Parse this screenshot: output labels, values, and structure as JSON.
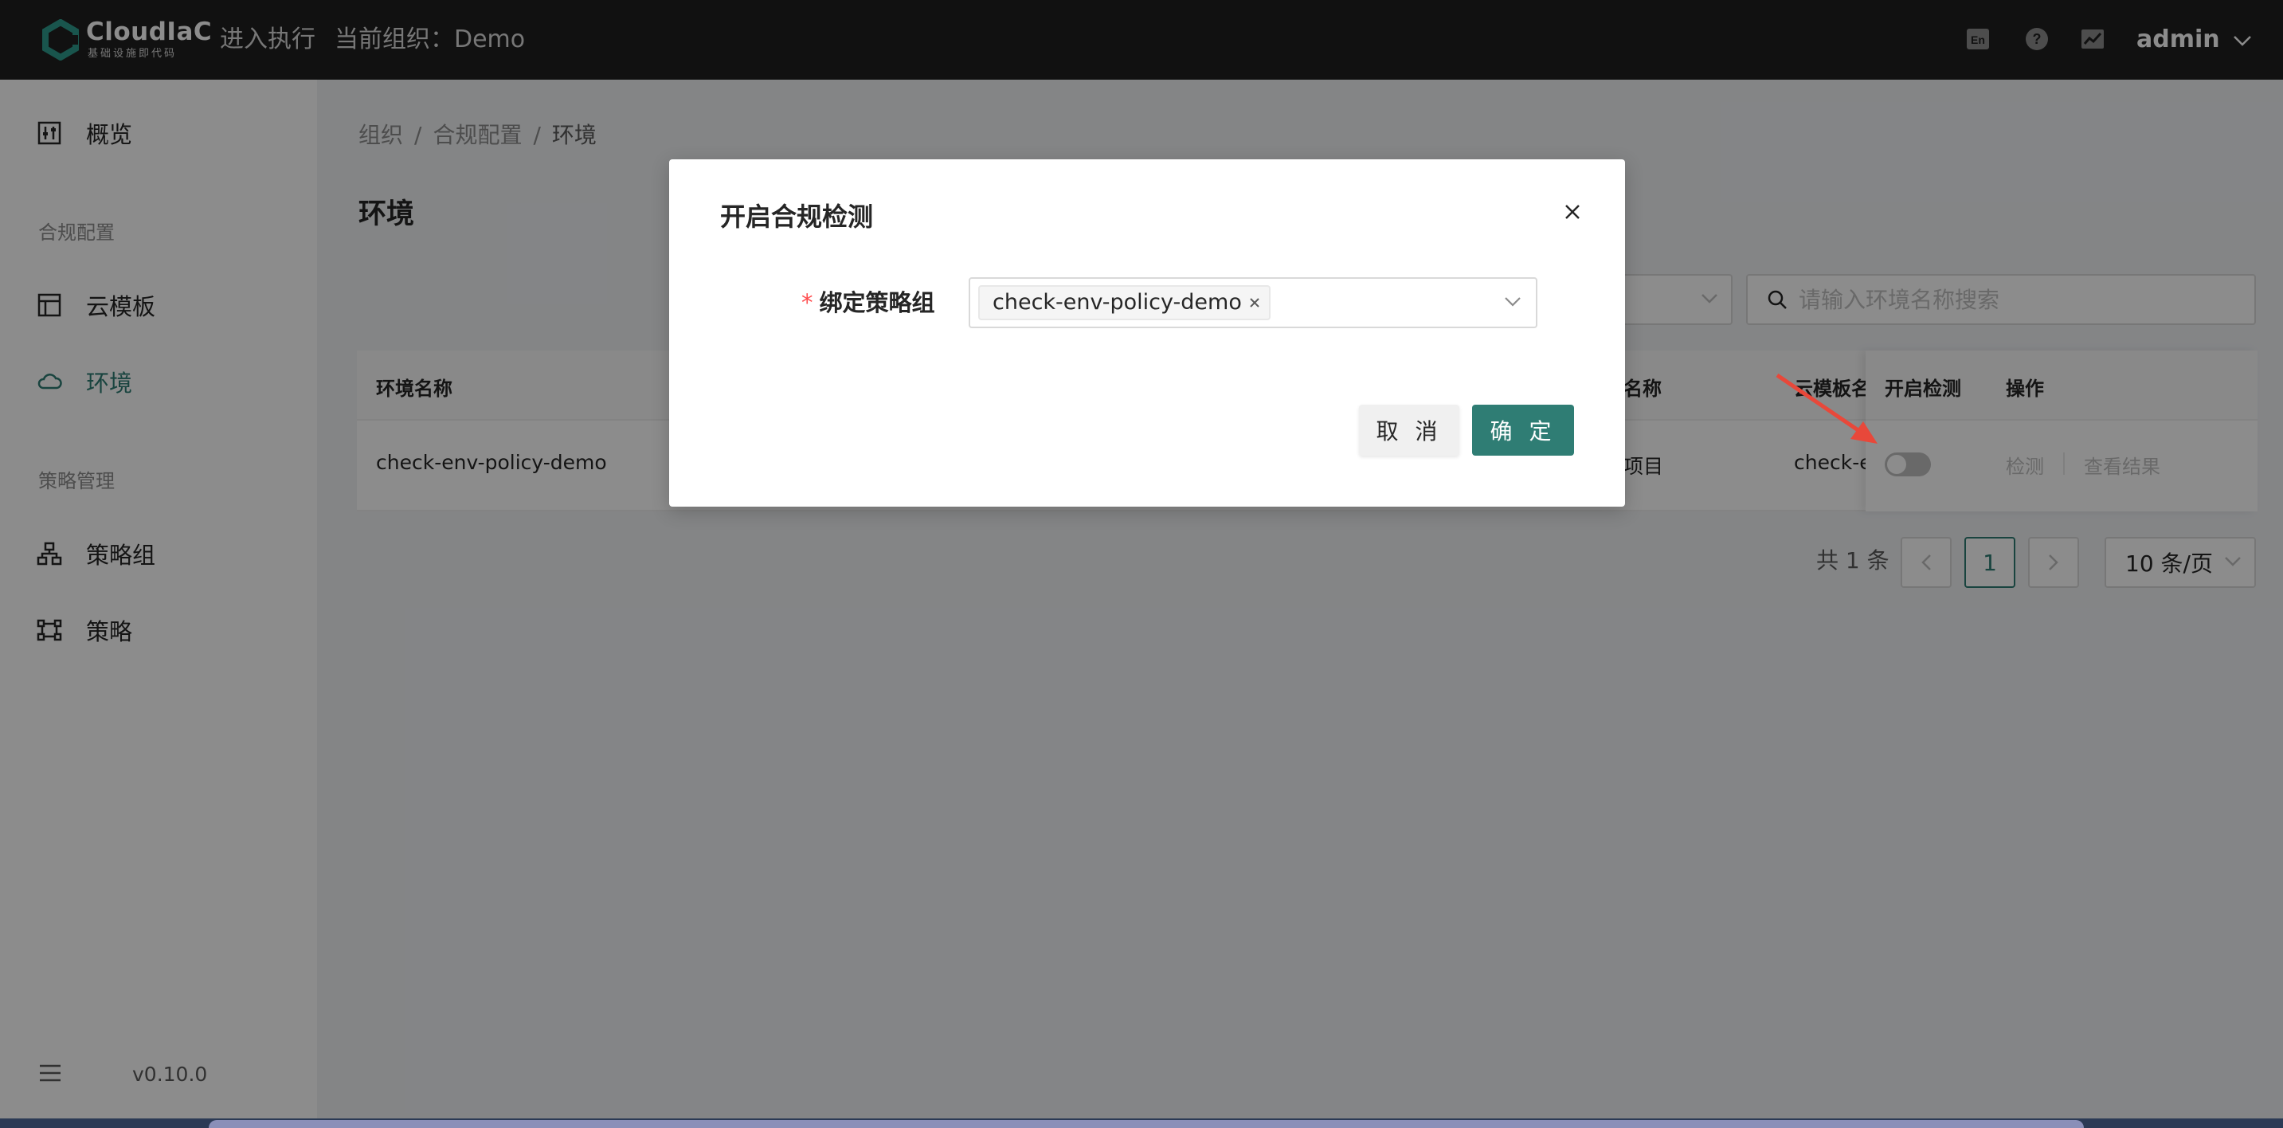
{
  "header": {
    "brand_name": "CloudIaC",
    "brand_sub": "基础设施即代码",
    "exec_link": "进入执行",
    "org_label": "当前组织：Demo",
    "lang_icon_text": "En",
    "user": "admin"
  },
  "sidebar": {
    "overview": "概览",
    "group_compliance": "合规配置",
    "cloud_template": "云模板",
    "environment": "环境",
    "group_policy": "策略管理",
    "policy_group": "策略组",
    "policy": "策略",
    "version": "v0.10.0"
  },
  "breadcrumb": [
    "组织",
    "合规配置",
    "环境"
  ],
  "page_title": "环境",
  "search": {
    "placeholder": "请输入环境名称搜索"
  },
  "table": {
    "columns": {
      "env_name": "环境名称",
      "project_name": "名称",
      "template_name": "云模板名",
      "enable_check": "开启检测",
      "actions": "操作"
    },
    "row": {
      "env_name": "check-env-policy-demo",
      "project_name": "项目",
      "template_name": "check-e",
      "check_enabled": false,
      "action_check": "检测",
      "action_view": "查看结果"
    }
  },
  "pagination": {
    "total": "共 1 条",
    "current_page": "1",
    "page_size": "10 条/页"
  },
  "modal": {
    "title": "开启合规检测",
    "field_required_mark": "*",
    "field_label": "绑定策略组",
    "selected_tag": "check-env-policy-demo",
    "cancel_label": "取 消",
    "ok_label": "确 定"
  },
  "colors": {
    "primary": "#2f7d74",
    "topbar": "#1f1f1f",
    "required": "#ff4d4f",
    "arrow": "#e8483a"
  }
}
